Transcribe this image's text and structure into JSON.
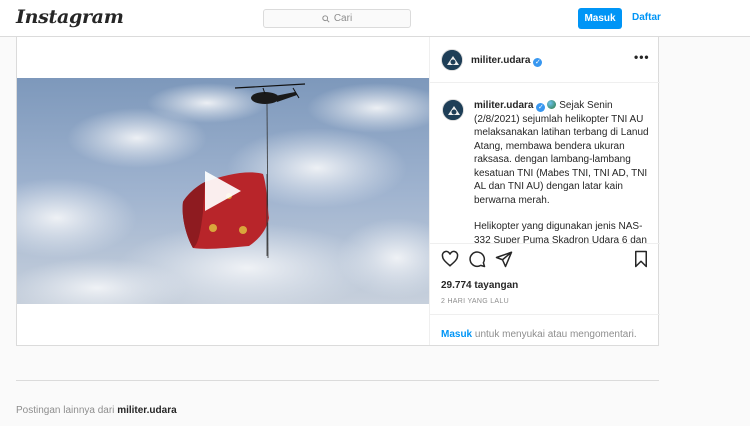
{
  "header": {
    "logo": "Instagram",
    "search_placeholder": "Cari",
    "login_label": "Masuk",
    "signup_label": "Daftar"
  },
  "post": {
    "username": "militer.udara",
    "caption_part1": "Sejak Senin (2/8/2021) sejumlah helikopter TNI AU melaksanakan latihan terbang di Lanud Atang, membawa bendera ukuran raksasa. dengan lambang-lambang kesatuan TNI (Mabes TNI, TNI AD, TNI AL dan TNI AU) dengan latar kain berwarna merah.",
    "caption_part2": "Helikopter yang digunakan jenis NAS-332 Super Puma Skadron Udara 6 dan",
    "views": "29.774 tayangan",
    "time": "2 HARI YANG LALU",
    "comment_login": "Masuk",
    "comment_text": "untuk menyukai atau mengomentari."
  },
  "footer": {
    "more_posts_prefix": "Postingan lainnya dari",
    "more_posts_user": "militer.udara"
  },
  "colors": {
    "accent": "#0095f6",
    "flag": "#c0262b",
    "sky": "#8ea6c4"
  },
  "icons": [
    "search-icon",
    "play-icon",
    "heart-icon",
    "comment-icon",
    "share-icon",
    "bookmark-icon",
    "more-icon",
    "verified-icon"
  ]
}
